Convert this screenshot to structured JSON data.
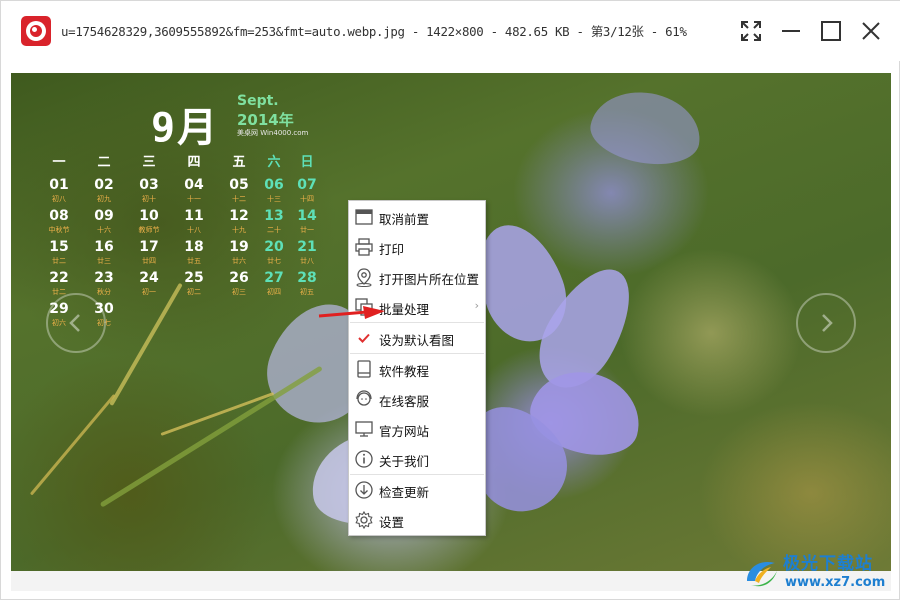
{
  "window": {
    "title": "u=1754628329,3609555892&fm=253&fmt=auto.webp.jpg - 1422×800 - 482.65 KB - 第3/12张 - 61%"
  },
  "calendar": {
    "month": "9月",
    "english_month": "Sept.",
    "year": "2014年",
    "brand": "美桌网  Win4000.com",
    "weekdays": [
      {
        "label": "一",
        "weekend": false
      },
      {
        "label": "二",
        "weekend": false
      },
      {
        "label": "三",
        "weekend": false
      },
      {
        "label": "四",
        "weekend": false
      },
      {
        "label": "五",
        "weekend": false
      },
      {
        "label": "六",
        "weekend": true
      },
      {
        "label": "日",
        "weekend": true
      }
    ],
    "days": [
      {
        "day": "01",
        "lunar": "初八"
      },
      {
        "day": "02",
        "lunar": "初九"
      },
      {
        "day": "03",
        "lunar": "初十"
      },
      {
        "day": "04",
        "lunar": "十一"
      },
      {
        "day": "05",
        "lunar": "十二"
      },
      {
        "day": "06",
        "lunar": "十三"
      },
      {
        "day": "07",
        "lunar": "十四"
      },
      {
        "day": "08",
        "lunar": "中秋节"
      },
      {
        "day": "09",
        "lunar": "十六"
      },
      {
        "day": "10",
        "lunar": "教师节"
      },
      {
        "day": "11",
        "lunar": "十八"
      },
      {
        "day": "12",
        "lunar": "十九"
      },
      {
        "day": "13",
        "lunar": "二十"
      },
      {
        "day": "14",
        "lunar": "廿一"
      },
      {
        "day": "15",
        "lunar": "廿二"
      },
      {
        "day": "16",
        "lunar": "廿三"
      },
      {
        "day": "17",
        "lunar": "廿四"
      },
      {
        "day": "18",
        "lunar": "廿五"
      },
      {
        "day": "19",
        "lunar": "廿六"
      },
      {
        "day": "20",
        "lunar": "廿七"
      },
      {
        "day": "21",
        "lunar": "廿八"
      },
      {
        "day": "22",
        "lunar": "廿二"
      },
      {
        "day": "23",
        "lunar": "秋分"
      },
      {
        "day": "24",
        "lunar": "初一"
      },
      {
        "day": "25",
        "lunar": "初二"
      },
      {
        "day": "26",
        "lunar": "初三"
      },
      {
        "day": "27",
        "lunar": "初四"
      },
      {
        "day": "28",
        "lunar": "初五"
      },
      {
        "day": "29",
        "lunar": "初六"
      },
      {
        "day": "30",
        "lunar": "初七"
      }
    ]
  },
  "context_menu": {
    "items": [
      {
        "label": "取消前置",
        "icon": "window-icon",
        "submenu": false,
        "checked": false
      },
      {
        "label": "打印",
        "icon": "printer-icon",
        "submenu": false,
        "checked": false
      },
      {
        "label": "打开图片所在位置",
        "icon": "location-pin-icon",
        "submenu": false,
        "checked": false
      },
      {
        "label": "批量处理",
        "icon": "batch-copy-icon",
        "submenu": true,
        "submenu_glyph": "›",
        "checked": false
      },
      {
        "label": "设为默认看图",
        "icon": "checkmark-icon",
        "submenu": false,
        "checked": true
      },
      {
        "label": "软件教程",
        "icon": "book-icon",
        "submenu": false,
        "checked": false
      },
      {
        "label": "在线客服",
        "icon": "headset-icon",
        "submenu": false,
        "checked": false
      },
      {
        "label": "官方网站",
        "icon": "monitor-icon",
        "submenu": false,
        "checked": false
      },
      {
        "label": "关于我们",
        "icon": "info-icon",
        "submenu": false,
        "checked": false
      },
      {
        "label": "检查更新",
        "icon": "download-icon",
        "submenu": false,
        "checked": false
      },
      {
        "label": "设置",
        "icon": "gear-icon",
        "submenu": false,
        "checked": false
      }
    ]
  },
  "watermark": {
    "title": "极光下载站",
    "url": "www.xz7.com"
  },
  "colors": {
    "brand_red": "#d9232b",
    "check_red": "#e03030",
    "calendar_weekend": "#5ee0b8",
    "calendar_lunar": "#f0b24a",
    "watermark_blue": "#1e7fd0"
  }
}
